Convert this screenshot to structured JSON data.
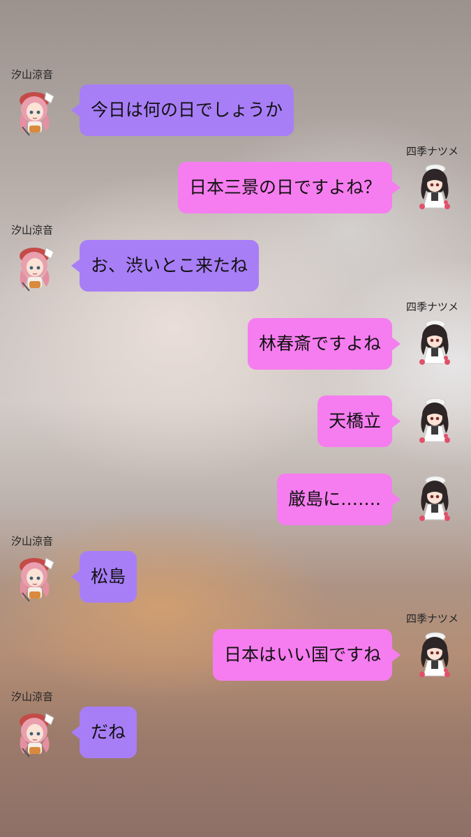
{
  "participants": {
    "left": "汐山涼音",
    "right": "四季ナツメ"
  },
  "colors": {
    "left_bubble": "#a87ef7",
    "right_bubble": "#f67df0"
  },
  "messages": [
    {
      "sender": "汐山涼音",
      "side": "left",
      "show_name": true,
      "text": "今日は何の日でしょうか"
    },
    {
      "sender": "四季ナツメ",
      "side": "right",
      "show_name": true,
      "text": "日本三景の日ですよね？"
    },
    {
      "sender": "汐山涼音",
      "side": "left",
      "show_name": true,
      "text": "お、渋いとこ来たね"
    },
    {
      "sender": "四季ナツメ",
      "side": "right",
      "show_name": true,
      "text": "林春斎ですよね"
    },
    {
      "sender": "四季ナツメ",
      "side": "right",
      "show_name": false,
      "text": "天橋立"
    },
    {
      "sender": "四季ナツメ",
      "side": "right",
      "show_name": false,
      "text": "厳島に……."
    },
    {
      "sender": "汐山涼音",
      "side": "left",
      "show_name": true,
      "text": "松島"
    },
    {
      "sender": "四季ナツメ",
      "side": "right",
      "show_name": true,
      "text": "日本はいい国ですね"
    },
    {
      "sender": "汐山涼音",
      "side": "left",
      "show_name": true,
      "text": "だね"
    }
  ]
}
